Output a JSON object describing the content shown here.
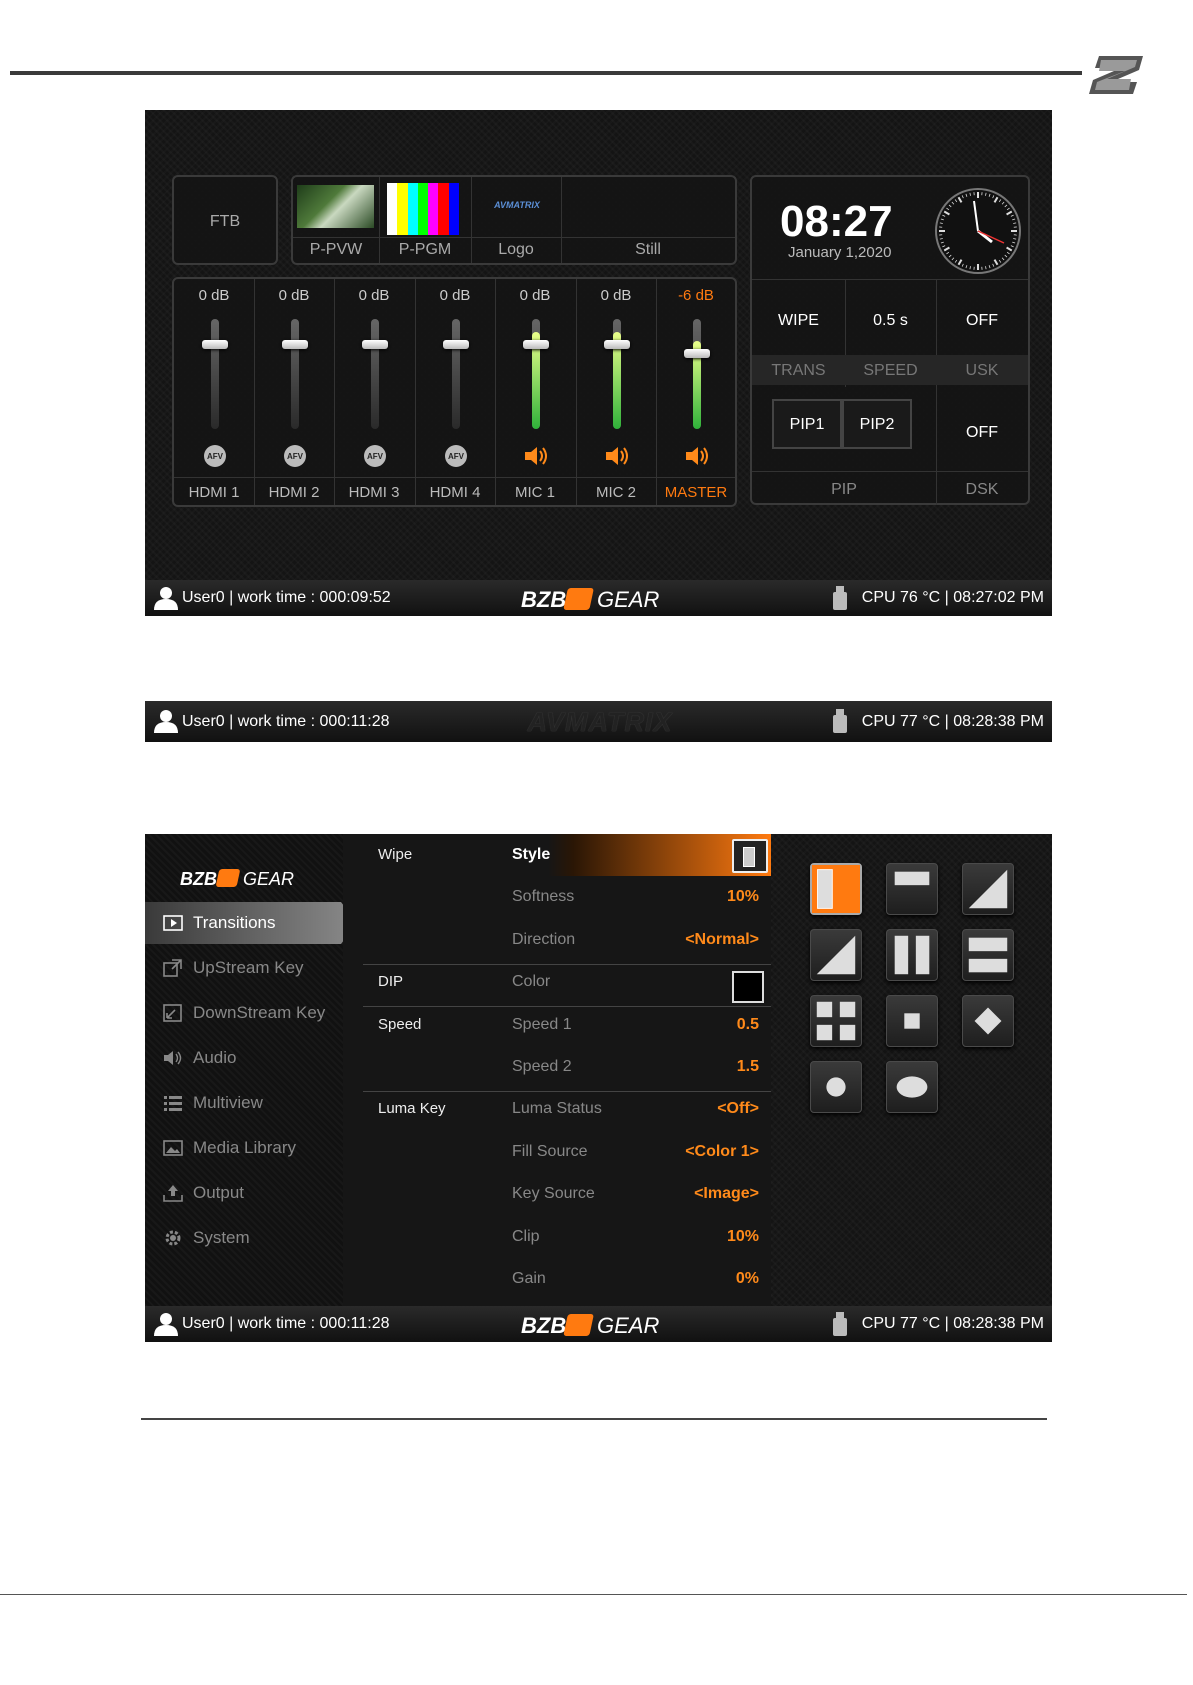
{
  "screen1": {
    "ftb_label": "FTB",
    "media": [
      {
        "label": "P-PVW"
      },
      {
        "label": "P-PGM"
      },
      {
        "label": "Logo",
        "logo_text": "AVMATRIX"
      },
      {
        "label": "Still"
      }
    ],
    "clock": {
      "time": "08:27",
      "date": "January 1,2020"
    },
    "audio": [
      {
        "db": "0 dB",
        "name": "HDMI 1",
        "icon": "afv-icon",
        "level": 0.88
      },
      {
        "db": "0 dB",
        "name": "HDMI 2",
        "icon": "afv-icon",
        "level": 0.88
      },
      {
        "db": "0 dB",
        "name": "HDMI 3",
        "icon": "afv-icon",
        "level": 0.88
      },
      {
        "db": "0 dB",
        "name": "HDMI 4",
        "icon": "afv-icon",
        "level": 0.88
      },
      {
        "db": "0 dB",
        "name": "MIC 1",
        "icon": "speaker-icon",
        "level": 0.88
      },
      {
        "db": "0 dB",
        "name": "MIC 2",
        "icon": "speaker-icon",
        "level": 0.88
      },
      {
        "db": "-6 dB",
        "name": "MASTER",
        "icon": "speaker-icon",
        "level": 0.8
      }
    ],
    "trans": {
      "value": "WIPE",
      "label": "TRANS"
    },
    "speed": {
      "value": "0.5 s",
      "label": "SPEED"
    },
    "usk": {
      "value": "OFF",
      "label": "USK"
    },
    "pip": {
      "pip1": "PIP1",
      "pip2": "PIP2",
      "label": "PIP"
    },
    "dsk": {
      "value": "OFF",
      "label": "DSK"
    },
    "status": {
      "left": "User0 | work time : 000:09:52",
      "right": "CPU 76 °C | 08:27:02 PM",
      "brand": "BZB GEAR"
    }
  },
  "screen2": {
    "status": {
      "left": "User0 | work time : 000:11:28",
      "right": "CPU 77 °C | 08:28:38 PM",
      "brand": "AVMATRIX"
    }
  },
  "screen3": {
    "logo": "BZB GEAR",
    "sidebar": [
      {
        "label": "Transitions",
        "icon": "play-icon"
      },
      {
        "label": "UpStream Key",
        "icon": "external-link-icon"
      },
      {
        "label": "DownStream Key",
        "icon": "corner-arrow-icon"
      },
      {
        "label": "Audio",
        "icon": "speaker-icon"
      },
      {
        "label": "Multiview",
        "icon": "list-icon"
      },
      {
        "label": "Media Library",
        "icon": "image-icon"
      },
      {
        "label": "Output",
        "icon": "upload-icon"
      },
      {
        "label": "System",
        "icon": "gear-icon"
      }
    ],
    "settings": [
      {
        "cat": "Wipe",
        "key": "Style",
        "val": ""
      },
      {
        "cat": "",
        "key": "Softness",
        "val": "10%"
      },
      {
        "cat": "",
        "key": "Direction",
        "val": "<Normal>"
      },
      {
        "cat": "DIP",
        "key": "Color",
        "val": ""
      },
      {
        "cat": "Speed",
        "key": "Speed 1",
        "val": "0.5"
      },
      {
        "cat": "",
        "key": "Speed 2",
        "val": "1.5"
      },
      {
        "cat": "Luma Key",
        "key": "Luma Status",
        "val": "<Off>"
      },
      {
        "cat": "",
        "key": "Fill Source",
        "val": "<Color 1>"
      },
      {
        "cat": "",
        "key": "Key Source",
        "val": "<Image>"
      },
      {
        "cat": "",
        "key": "Clip",
        "val": "10%"
      },
      {
        "cat": "",
        "key": "Gain",
        "val": "0%"
      }
    ],
    "wipe_styles": [
      "vertical-bar",
      "horizontal-bar",
      "diagonal-tr",
      "diagonal-bl",
      "double-vertical",
      "double-horizontal",
      "four-squares",
      "center-square",
      "diamond",
      "circle",
      "ellipse"
    ],
    "status": {
      "left": "User0 | work time : 000:11:28",
      "right": "CPU 77 °C | 08:28:38 PM",
      "brand": "BZB GEAR"
    }
  },
  "colors": {
    "accent": "#ff7a10",
    "bg": "#141414",
    "green": "#7ee06a"
  }
}
